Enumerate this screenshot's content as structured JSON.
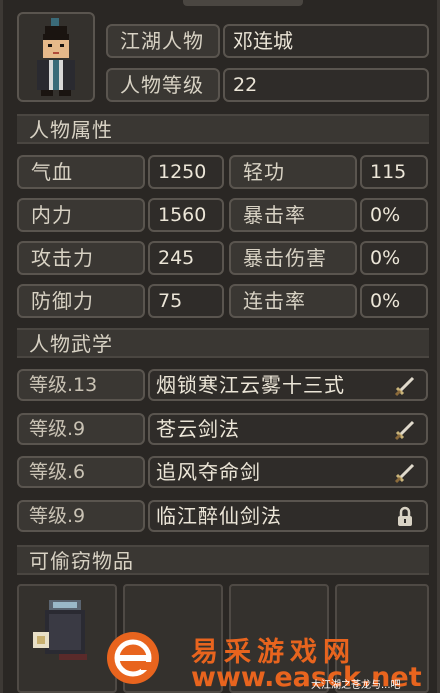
{
  "character": {
    "name_label": "江湖人物",
    "name_value": "邓连城",
    "level_label": "人物等级",
    "level_value": "22"
  },
  "attributes": {
    "section_title": "人物属性",
    "rows": [
      {
        "left_label": "气血",
        "left_value": "1250",
        "right_label": "轻功",
        "right_value": "115"
      },
      {
        "left_label": "内力",
        "left_value": "1560",
        "right_label": "暴击率",
        "right_value": "0%"
      },
      {
        "left_label": "攻击力",
        "left_value": "245",
        "right_label": "暴击伤害",
        "right_value": "0%"
      },
      {
        "left_label": "防御力",
        "left_value": "75",
        "right_label": "连击率",
        "right_value": "0%"
      }
    ]
  },
  "martial_arts": {
    "section_title": "人物武学",
    "skills": [
      {
        "level": "等级.13",
        "name": "烟锁寒江云雾十三式",
        "icon": "sword-icon"
      },
      {
        "level": "等级.9",
        "name": "苍云剑法",
        "icon": "sword-icon"
      },
      {
        "level": "等级.6",
        "name": "追风夺命剑",
        "icon": "sword-icon"
      },
      {
        "level": "等级.9",
        "name": "临江醉仙剑法",
        "icon": "lock-icon"
      }
    ]
  },
  "stealable": {
    "section_title": "可偷窃物品"
  },
  "watermark": {
    "site_name": "易采游戏网",
    "url": "www.easck.net",
    "small_text": "大江湖之苍龙与...吧"
  }
}
